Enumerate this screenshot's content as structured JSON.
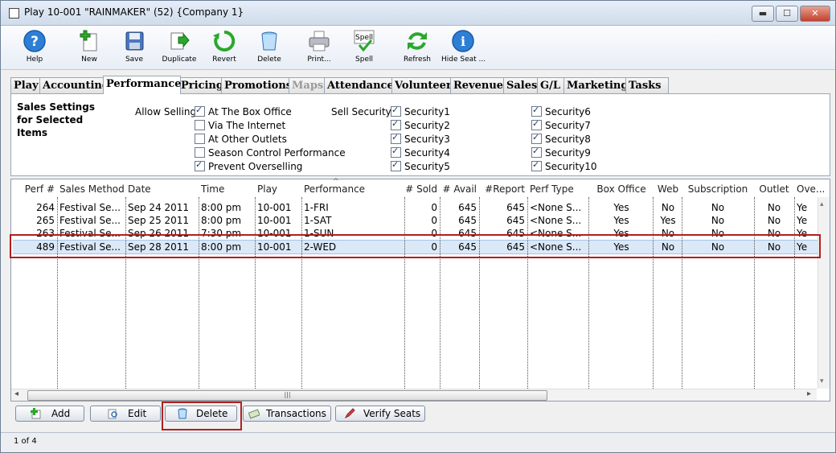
{
  "window": {
    "title": "Play 10-001 \"RAINMAKER\" (52) {Company 1}"
  },
  "window_controls": {
    "minimize": "▬",
    "maximize": "☐",
    "close": "✕"
  },
  "toolbar": {
    "buttons": [
      {
        "label": "Help",
        "icon": "help-icon"
      },
      {
        "label": "New",
        "icon": "new-icon"
      },
      {
        "label": "Save",
        "icon": "save-icon"
      },
      {
        "label": "Duplicate",
        "icon": "duplicate-icon"
      },
      {
        "label": "Revert",
        "icon": "revert-icon"
      },
      {
        "label": "Delete",
        "icon": "delete-icon"
      },
      {
        "label": "Print...",
        "icon": "print-icon"
      },
      {
        "label": "Spell",
        "icon": "spell-icon",
        "icon_text": "Spell"
      },
      {
        "label": "Refresh",
        "icon": "refresh-icon"
      },
      {
        "label": "Hide Seat ...",
        "icon": "info-icon"
      }
    ]
  },
  "tabs": [
    {
      "label": "Play"
    },
    {
      "label": "Accounting"
    },
    {
      "label": "Performance",
      "active": true
    },
    {
      "label": "Pricing"
    },
    {
      "label": "Promotions"
    },
    {
      "label": "Maps",
      "disabled": true
    },
    {
      "label": "Attendance"
    },
    {
      "label": "Volunteer"
    },
    {
      "label": "Revenue"
    },
    {
      "label": "Sales"
    },
    {
      "label": "G/L"
    },
    {
      "label": "Marketing"
    },
    {
      "label": "Tasks"
    }
  ],
  "sales_settings": {
    "title": "Sales Settings for Selected Items",
    "allow_selling_label": "Allow Selling",
    "allow_selling": [
      {
        "label": "At The Box Office",
        "checked": true
      },
      {
        "label": "Via The Internet",
        "checked": false
      },
      {
        "label": "At Other Outlets",
        "checked": false
      },
      {
        "label": "Season Control Performance",
        "checked": false
      },
      {
        "label": "Prevent Overselling",
        "checked": true
      }
    ],
    "sell_security_label": "Sell Security",
    "security": [
      {
        "label": "Security1",
        "checked": true
      },
      {
        "label": "Security2",
        "checked": true
      },
      {
        "label": "Security3",
        "checked": true
      },
      {
        "label": "Security4",
        "checked": true
      },
      {
        "label": "Security5",
        "checked": true
      },
      {
        "label": "Security6",
        "checked": true
      },
      {
        "label": "Security7",
        "checked": true
      },
      {
        "label": "Security8",
        "checked": true
      },
      {
        "label": "Security9",
        "checked": true
      },
      {
        "label": "Security10",
        "checked": true
      }
    ]
  },
  "grid": {
    "columns": [
      "Perf #",
      "Sales Method",
      "Date",
      "Time",
      "Play",
      "Performance",
      "# Sold",
      "# Avail",
      "#Report",
      "Perf Type",
      "Box Office",
      "Web",
      "Subscription",
      "Outlet",
      "Ove..."
    ],
    "rows": [
      [
        "264",
        "Festival Se...",
        "Sep 24 2011",
        "8:00 pm",
        "10-001",
        "1-FRI",
        "0",
        "645",
        "645",
        "<None S...",
        "Yes",
        "No",
        "No",
        "No",
        "Ye"
      ],
      [
        "265",
        "Festival Se...",
        "Sep 25 2011",
        "8:00 pm",
        "10-001",
        "1-SAT",
        "0",
        "645",
        "645",
        "<None S...",
        "Yes",
        "Yes",
        "No",
        "No",
        "Ye"
      ],
      [
        "263",
        "Festival Se...",
        "Sep 26 2011",
        "7:30 pm",
        "10-001",
        "1-SUN",
        "0",
        "645",
        "645",
        "<None S...",
        "Yes",
        "No",
        "No",
        "No",
        "Ye"
      ],
      [
        "489",
        "Festival Se...",
        "Sep 28 2011",
        "8:00 pm",
        "10-001",
        "2-WED",
        "0",
        "645",
        "645",
        "<None S...",
        "Yes",
        "No",
        "No",
        "No",
        "Ye"
      ]
    ],
    "selected_row": 3,
    "scroll_left": "◂",
    "scroll_right": "▸",
    "scroll_up": "▴",
    "scroll_down": "▾",
    "thumb_grip": "|||",
    "sort_marker": "^"
  },
  "actions": {
    "add": "Add",
    "edit": "Edit",
    "delete": "Delete",
    "transactions": "Transactions",
    "verify_seats": "Verify Seats"
  },
  "status": {
    "record": "1 of 4"
  }
}
